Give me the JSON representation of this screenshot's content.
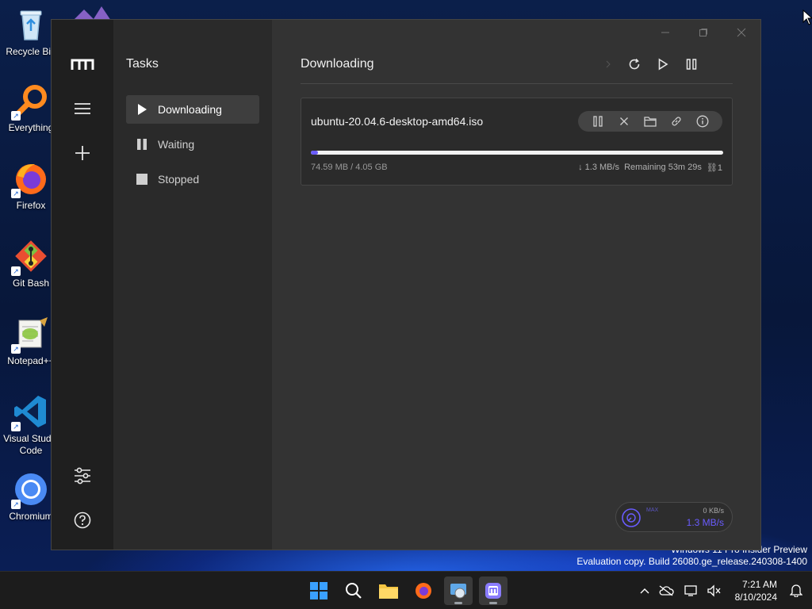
{
  "desktop": {
    "icons": [
      {
        "label": "Recycle Bin",
        "icon": "recycle-bin-icon"
      },
      {
        "label": "Everything",
        "icon": "everything-search-icon"
      },
      {
        "label": "Firefox",
        "icon": "firefox-icon"
      },
      {
        "label": "Git Bash",
        "icon": "git-bash-icon"
      },
      {
        "label": "Notepad++",
        "icon": "notepad-plus-plus-icon"
      },
      {
        "label": "Visual Studio Code",
        "icon": "vscode-icon"
      },
      {
        "label": "Chromium",
        "icon": "chromium-icon"
      }
    ],
    "watermark_line1": "Windows 11 Pro Insider Preview",
    "watermark_line2": "Evaluation copy. Build 26080.ge_release.240308-1400"
  },
  "app": {
    "sidebar_title": "Tasks",
    "nav": [
      {
        "label": "Downloading",
        "icon": "play-icon",
        "active": true
      },
      {
        "label": "Waiting",
        "icon": "pause-icon",
        "active": false
      },
      {
        "label": "Stopped",
        "icon": "stop-icon",
        "active": false
      }
    ],
    "main_title": "Downloading",
    "task": {
      "name": "ubuntu-20.04.6-desktop-amd64.iso",
      "size": "74.59 MB / 4.05 GB",
      "speed": "↓ 1.3 MB/s",
      "remaining": "Remaining 53m 29s",
      "connections": "⛓1",
      "progress": 0.018
    },
    "speedometer": {
      "max_label": "MAX",
      "upload": "0 KB/s",
      "download": "1.3 MB/s"
    },
    "colors": {
      "accent": "#6a5cff",
      "rail": "#1f1f1f",
      "sidebar": "#2a2a2a",
      "main": "#333333"
    }
  },
  "taskbar": {
    "time": "7:21 AM",
    "date": "8/10/2024"
  }
}
